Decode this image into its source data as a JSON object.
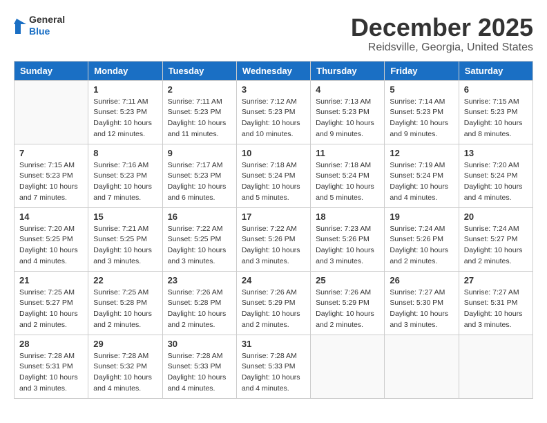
{
  "logo": {
    "line1": "General",
    "line2": "Blue"
  },
  "title": "December 2025",
  "location": "Reidsville, Georgia, United States",
  "days_of_week": [
    "Sunday",
    "Monday",
    "Tuesday",
    "Wednesday",
    "Thursday",
    "Friday",
    "Saturday"
  ],
  "weeks": [
    [
      {
        "day": "",
        "info": ""
      },
      {
        "day": "1",
        "info": "Sunrise: 7:11 AM\nSunset: 5:23 PM\nDaylight: 10 hours\nand 12 minutes."
      },
      {
        "day": "2",
        "info": "Sunrise: 7:11 AM\nSunset: 5:23 PM\nDaylight: 10 hours\nand 11 minutes."
      },
      {
        "day": "3",
        "info": "Sunrise: 7:12 AM\nSunset: 5:23 PM\nDaylight: 10 hours\nand 10 minutes."
      },
      {
        "day": "4",
        "info": "Sunrise: 7:13 AM\nSunset: 5:23 PM\nDaylight: 10 hours\nand 9 minutes."
      },
      {
        "day": "5",
        "info": "Sunrise: 7:14 AM\nSunset: 5:23 PM\nDaylight: 10 hours\nand 9 minutes."
      },
      {
        "day": "6",
        "info": "Sunrise: 7:15 AM\nSunset: 5:23 PM\nDaylight: 10 hours\nand 8 minutes."
      }
    ],
    [
      {
        "day": "7",
        "info": "Sunrise: 7:15 AM\nSunset: 5:23 PM\nDaylight: 10 hours\nand 7 minutes."
      },
      {
        "day": "8",
        "info": "Sunrise: 7:16 AM\nSunset: 5:23 PM\nDaylight: 10 hours\nand 7 minutes."
      },
      {
        "day": "9",
        "info": "Sunrise: 7:17 AM\nSunset: 5:23 PM\nDaylight: 10 hours\nand 6 minutes."
      },
      {
        "day": "10",
        "info": "Sunrise: 7:18 AM\nSunset: 5:24 PM\nDaylight: 10 hours\nand 5 minutes."
      },
      {
        "day": "11",
        "info": "Sunrise: 7:18 AM\nSunset: 5:24 PM\nDaylight: 10 hours\nand 5 minutes."
      },
      {
        "day": "12",
        "info": "Sunrise: 7:19 AM\nSunset: 5:24 PM\nDaylight: 10 hours\nand 4 minutes."
      },
      {
        "day": "13",
        "info": "Sunrise: 7:20 AM\nSunset: 5:24 PM\nDaylight: 10 hours\nand 4 minutes."
      }
    ],
    [
      {
        "day": "14",
        "info": "Sunrise: 7:20 AM\nSunset: 5:25 PM\nDaylight: 10 hours\nand 4 minutes."
      },
      {
        "day": "15",
        "info": "Sunrise: 7:21 AM\nSunset: 5:25 PM\nDaylight: 10 hours\nand 3 minutes."
      },
      {
        "day": "16",
        "info": "Sunrise: 7:22 AM\nSunset: 5:25 PM\nDaylight: 10 hours\nand 3 minutes."
      },
      {
        "day": "17",
        "info": "Sunrise: 7:22 AM\nSunset: 5:26 PM\nDaylight: 10 hours\nand 3 minutes."
      },
      {
        "day": "18",
        "info": "Sunrise: 7:23 AM\nSunset: 5:26 PM\nDaylight: 10 hours\nand 3 minutes."
      },
      {
        "day": "19",
        "info": "Sunrise: 7:24 AM\nSunset: 5:26 PM\nDaylight: 10 hours\nand 2 minutes."
      },
      {
        "day": "20",
        "info": "Sunrise: 7:24 AM\nSunset: 5:27 PM\nDaylight: 10 hours\nand 2 minutes."
      }
    ],
    [
      {
        "day": "21",
        "info": "Sunrise: 7:25 AM\nSunset: 5:27 PM\nDaylight: 10 hours\nand 2 minutes."
      },
      {
        "day": "22",
        "info": "Sunrise: 7:25 AM\nSunset: 5:28 PM\nDaylight: 10 hours\nand 2 minutes."
      },
      {
        "day": "23",
        "info": "Sunrise: 7:26 AM\nSunset: 5:28 PM\nDaylight: 10 hours\nand 2 minutes."
      },
      {
        "day": "24",
        "info": "Sunrise: 7:26 AM\nSunset: 5:29 PM\nDaylight: 10 hours\nand 2 minutes."
      },
      {
        "day": "25",
        "info": "Sunrise: 7:26 AM\nSunset: 5:29 PM\nDaylight: 10 hours\nand 2 minutes."
      },
      {
        "day": "26",
        "info": "Sunrise: 7:27 AM\nSunset: 5:30 PM\nDaylight: 10 hours\nand 3 minutes."
      },
      {
        "day": "27",
        "info": "Sunrise: 7:27 AM\nSunset: 5:31 PM\nDaylight: 10 hours\nand 3 minutes."
      }
    ],
    [
      {
        "day": "28",
        "info": "Sunrise: 7:28 AM\nSunset: 5:31 PM\nDaylight: 10 hours\nand 3 minutes."
      },
      {
        "day": "29",
        "info": "Sunrise: 7:28 AM\nSunset: 5:32 PM\nDaylight: 10 hours\nand 4 minutes."
      },
      {
        "day": "30",
        "info": "Sunrise: 7:28 AM\nSunset: 5:33 PM\nDaylight: 10 hours\nand 4 minutes."
      },
      {
        "day": "31",
        "info": "Sunrise: 7:28 AM\nSunset: 5:33 PM\nDaylight: 10 hours\nand 4 minutes."
      },
      {
        "day": "",
        "info": ""
      },
      {
        "day": "",
        "info": ""
      },
      {
        "day": "",
        "info": ""
      }
    ]
  ]
}
